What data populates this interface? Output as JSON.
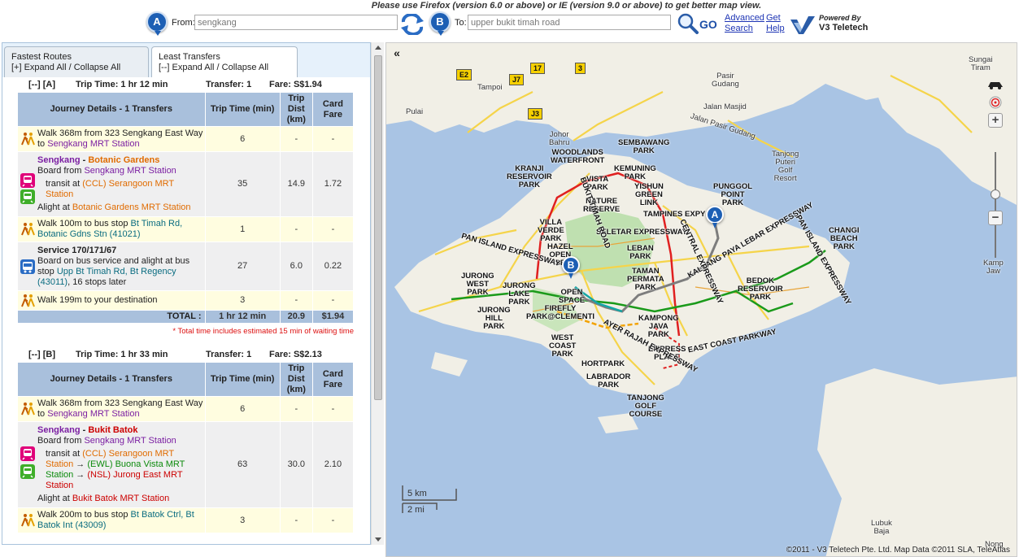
{
  "notice": "Please use Firefox (version 6.0 or above) or IE (version 9.0 or above) to get better map view.",
  "search": {
    "marker_a": "A",
    "marker_b": "B",
    "from_label": "From:",
    "from_value": "sengkang",
    "to_label": "To:",
    "to_value": "upper bukit timah road",
    "go_label": "GO",
    "advanced_search_1": "Advanced",
    "advanced_search_2": "Search",
    "get_help_1": "Get",
    "get_help_2": "Help",
    "powered_small": "Powered By",
    "powered_brand": "V3 Teletech"
  },
  "tabs": [
    {
      "title": "Fastest Routes",
      "sub": "[+] Expand All / Collapse All"
    },
    {
      "title": "Least Transfers",
      "sub": "[--] Expand All / Collapse All"
    }
  ],
  "table_headers": {
    "journey_a": "Journey Details - 1 Transfers",
    "journey_b": "Journey Details - 1 Transfers",
    "trip_time": "Trip Time (min)",
    "trip_dist": "Trip Dist (km)",
    "card_fare": "Card Fare"
  },
  "routes": [
    {
      "toggle": "[--] [A]",
      "trip_time": "Trip Time: 1 hr 12 min",
      "transfer": "Transfer: 1",
      "fare": "Fare: S$1.94",
      "walk1": {
        "pre": "Walk 368m from 323 Sengkang East Way to ",
        "station": "Sengkang MRT Station",
        "time": "6",
        "dist": "-",
        "fare": "-"
      },
      "rail": {
        "line_from": "Sengkang",
        "sep": " - ",
        "line_to": "Botanic Gardens",
        "board_pre": "Board from ",
        "board_station": "Sengkang MRT Station",
        "transit_pre": "transit at ",
        "transit_station": "(CCL) Serangoon MRT Station",
        "alight_pre": "Alight at ",
        "alight_station": "Botanic Gardens MRT Station",
        "time": "35",
        "dist": "14.9",
        "fare": "1.72"
      },
      "walk2": {
        "pre": "Walk 100m to bus stop ",
        "stop": "Bt Timah Rd, Botanic Gdns Stn (41021)",
        "time": "1",
        "dist": "-",
        "fare": "-"
      },
      "bus": {
        "title": "Service 170/171/67",
        "pre": "Board on bus service and alight at bus stop ",
        "stop": "Upp Bt Timah Rd, Bt Regency (43011)",
        "post": ", 16 stops later",
        "time": "27",
        "dist": "6.0",
        "fare": "0.22"
      },
      "walk3": {
        "text": "Walk 199m to your destination",
        "time": "3",
        "dist": "-",
        "fare": "-"
      },
      "total": {
        "label": "TOTAL :",
        "time": "1 hr 12 min",
        "dist": "20.9",
        "fare": "$1.94"
      },
      "note": "* Total time includes estimated 15 min of waiting time"
    },
    {
      "toggle": "[--] [B]",
      "trip_time": "Trip Time: 1 hr 33 min",
      "transfer": "Transfer: 1",
      "fare": "Fare: S$2.13",
      "walk1": {
        "pre": "Walk 368m from 323 Sengkang East Way to ",
        "station": "Sengkang MRT Station",
        "time": "6",
        "dist": "-",
        "fare": "-"
      },
      "rail": {
        "line_from": "Sengkang",
        "sep": " - ",
        "line_to": "Bukit Batok",
        "board_pre": "Board from ",
        "board_station": "Sengkang MRT Station",
        "transit_pre": "transit at ",
        "transit_station1": "(CCL) Serangoon MRT Station",
        "arrow": " → ",
        "transit_station2": "(EWL) Buona Vista MRT Station",
        "transit_station3": "(NSL) Jurong East MRT Station",
        "alight_pre": "Alight at ",
        "alight_station": "Bukit Batok MRT Station",
        "time": "63",
        "dist": "30.0",
        "fare": "2.10"
      },
      "walk2": {
        "pre": "Walk 200m to bus stop ",
        "stop": "Bt Batok Ctrl, Bt Batok Int (43009)",
        "time": "3",
        "dist": "-",
        "fare": "-"
      }
    }
  ],
  "map": {
    "collapse_glyph": "«",
    "pin_a": "A",
    "pin_b": "B",
    "zoom_in": "+",
    "zoom_out": "−",
    "scale_km": "5 km",
    "scale_mi": "2 mi",
    "copyright": "©2011 - V3 Teletech Pte. Ltd. Map Data ©2011 SLA, TeleAtlas",
    "shields": [
      "E2",
      "J7",
      "17",
      "3",
      "J3"
    ],
    "places": [
      "SEMBAWANG\nPARK",
      "WOODLANDS\nWATERFRONT",
      "KRANJI\nRESERVOIR\nPARK",
      "VISTA\nPARK",
      "KEMUNING\nPARK",
      "YISHUN\nGREEN\nLINK",
      "NATURE\nRESERVE",
      "PUNGGOL\nPOINT\nPARK",
      "TAMPINES EXPY",
      "VILLA\nVERDE\nPARK",
      "HAZEL\nOPEN\nSP",
      "LEBAN\nPARK",
      "TAMAN\nPERMATA\nPARK",
      "CHANGI\nBEACH\nPARK",
      "BEDOK\nRESERVOIR\nPARK",
      "JURONG\nWEST\nPARK",
      "JURONG\nLAKE\nPARK",
      "OPEN\nSPACE",
      "FIREFLY\nPARK@CLEMENTI",
      "JURONG\nHILL\nPARK",
      "KAMPONG\nJAVA\nPARK",
      "EMPRESS\nPLACE",
      "WEST\nCOAST\nPARK",
      "HORTPARK",
      "LABRADOR\nPARK",
      "TANJONG\nGOLF\nCOURSE",
      "SELETAR EXPRESSWAY",
      "PAN ISLAND EXPRESSWAY",
      "KALLANG PAYA LEBAR EXPRESSWAY",
      "EAST COAST PARKWAY",
      "AYER RAJAH EXPRESSWAY",
      "BUKIT TIMAH ROAD",
      "CENTRAL EXPRESSWAY",
      "PAN ISLAND EXPRESSWAY",
      "Sungai\nTiram",
      "Pasir\nGudang",
      "Tanjong\nPuteri\nGolf\nResort",
      "Kamp\nJaw",
      "Lubuk\nBaja",
      "Nong",
      "Tampoi",
      "Pulai",
      "Johor\nBahru",
      "Jalan Masjid",
      "Jalan Pasir Gudang"
    ]
  },
  "colors": {
    "accent": "#1d5fb4",
    "header_blue": "#a9c0dc",
    "walk_bg": "#fffde0",
    "rail_bg": "#efeff0",
    "mrt_purple": "#7b1fa2",
    "ccl_orange": "#e06b00",
    "ewl_green": "#0b8a0b",
    "nsl_red": "#cc0000",
    "bus_teal": "#0a6c80",
    "sea": "#a9c4e4",
    "land": "#f1efe6"
  }
}
